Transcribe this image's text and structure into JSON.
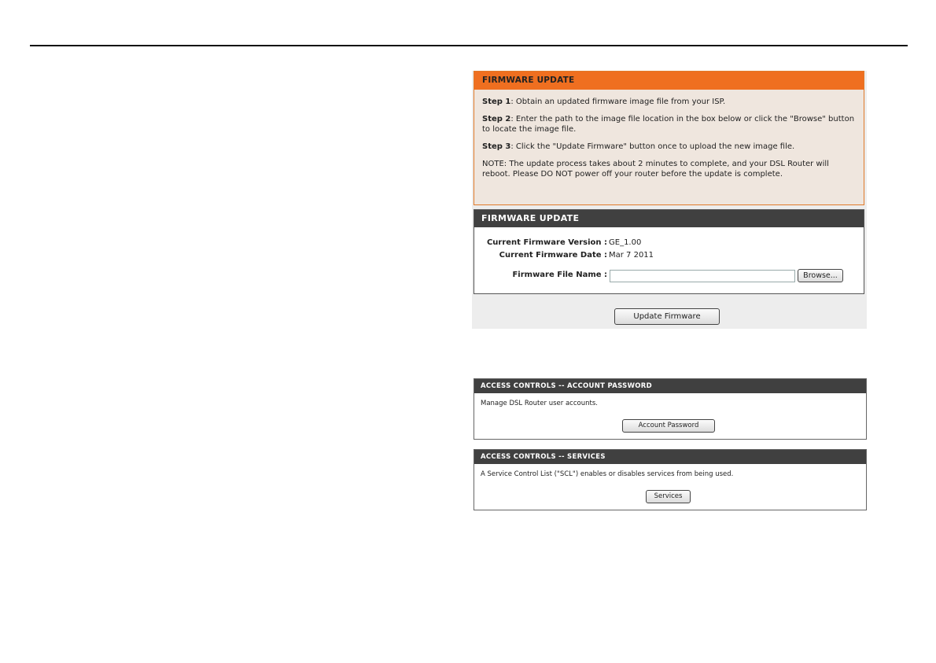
{
  "firmware_info": {
    "header": "FIRMWARE UPDATE",
    "step1_label": "Step 1",
    "step1_text": ": Obtain an updated firmware image file from your ISP.",
    "step2_label": "Step 2",
    "step2_text": ": Enter the path to the image file location in the box below or click the \"Browse\" button to locate the image file.",
    "step3_label": "Step 3",
    "step3_text": ": Click the \"Update Firmware\" button once to upload the new image file.",
    "note": "NOTE: The update process takes about 2 minutes to complete, and your DSL Router will reboot. Please DO NOT power off your router before the update is complete."
  },
  "firmware_panel": {
    "header": "FIRMWARE UPDATE",
    "version_label": "Current Firmware Version :",
    "version_value": "GE_1.00",
    "date_label": "Current Firmware Date :",
    "date_value": "Mar 7 2011",
    "file_label": "Firmware File Name :",
    "file_value": "",
    "browse_label": "Browse...",
    "update_label": "Update Firmware"
  },
  "account_password": {
    "header": "ACCESS CONTROLS -- ACCOUNT PASSWORD",
    "description": "Manage DSL Router user accounts.",
    "button_label": "Account Password"
  },
  "services": {
    "header": "ACCESS CONTROLS -- SERVICES",
    "description": "A Service Control List (\"SCL\") enables or disables services from being used.",
    "button_label": "Services"
  },
  "colors": {
    "orange_header": "#ef6f20",
    "dark_header": "#404040",
    "info_background": "#efe6de"
  }
}
